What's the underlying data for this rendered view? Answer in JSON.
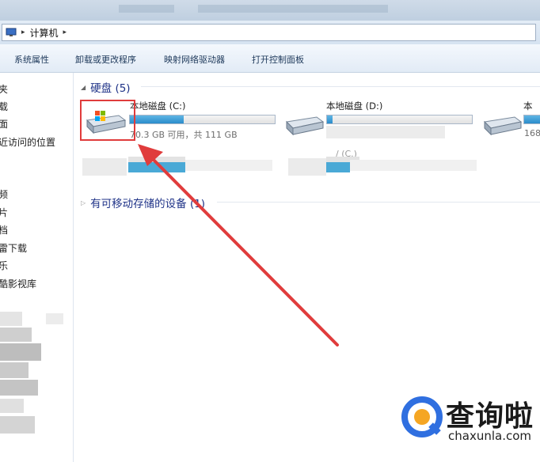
{
  "address": {
    "separator_1": "▸",
    "crumb": "计算机",
    "separator_2": "▸"
  },
  "toolbar": {
    "items": [
      "系统属性",
      "卸载或更改程序",
      "映射网络驱动器",
      "打开控制面板"
    ]
  },
  "nav": {
    "items": [
      "夹",
      "载",
      "面",
      "近访问的位置",
      "频",
      "片",
      "档",
      "雷下载",
      "乐",
      "酷影视库"
    ]
  },
  "groups": {
    "hard_disks": {
      "title": "硬盘 (5)"
    },
    "removable": {
      "title": "有可移动存储的设备 (1)"
    }
  },
  "drives": [
    {
      "name": "本地磁盘 (C:)",
      "size": "70.3 GB 可用，共 111 GB",
      "fill_fraction": 0.37
    },
    {
      "name": "本地磁盘 (D:)",
      "size": "",
      "fill_fraction": 0.04
    },
    {
      "name": "本",
      "size": "168",
      "fill_fraction": 1.0
    }
  ],
  "partial_text": "/ (C.)",
  "watermark": {
    "text": "查询啦",
    "url": "chaxunla.com",
    "colors": {
      "blue": "#2f6fe0",
      "orange": "#f5a623"
    }
  },
  "colors": {
    "highlight": "#e03c3c",
    "group_title": "#1e3287",
    "bar_fill": "#2a8ccb"
  }
}
